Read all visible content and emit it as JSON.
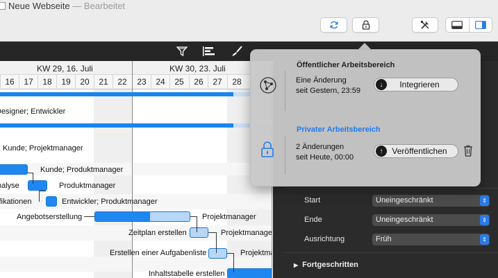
{
  "window": {
    "title": "Neue Webseite",
    "separator": "—",
    "status": "Bearbeitet"
  },
  "toolbar": {
    "sync_icon": "sync-icon",
    "lock_icon": "lock-icon",
    "tools_icon": "tools-icon",
    "layout_icons": [
      "layout-bottom-icon",
      "layout-right-icon"
    ]
  },
  "inspector_toolbar": {
    "icons": [
      "filter-icon",
      "alignment-icon",
      "brush-icon"
    ]
  },
  "gantt": {
    "weeks": [
      "KW 29, 16. Juli",
      "KW 30, 23. Juli"
    ],
    "days": [
      "16",
      "17",
      "18",
      "19",
      "20",
      "21",
      "22",
      "23",
      "24",
      "25",
      "26",
      "27",
      "28"
    ],
    "rows": [
      {
        "label": "Designer; Entwickler"
      },
      {
        "label": "Kunde; Projektmanager"
      },
      {
        "label": "Kunde; Produktmanager"
      },
      {
        "label": "nalyse"
      },
      {
        "label": "Produktmanager"
      },
      {
        "label": "ifikationen"
      },
      {
        "label": "Entwickler; Produktmanager"
      },
      {
        "label": "Angebotserstellung"
      },
      {
        "label": "Projektmanager"
      },
      {
        "label": "Zeitplan erstellen"
      },
      {
        "label": "Projektmanager"
      },
      {
        "label": "Erstellen einer Aufgabenliste"
      },
      {
        "label": "Projektmanager"
      },
      {
        "label": "Inhaltstabelle erstellen"
      }
    ]
  },
  "inspector": {
    "fields": [
      {
        "label": "Start",
        "value": "Uneingeschränkt"
      },
      {
        "label": "Ende",
        "value": "Uneingeschränkt"
      },
      {
        "label": "Ausrichtung",
        "value": "Früh"
      }
    ],
    "advanced_label": "Fortgeschritten"
  },
  "popover": {
    "public": {
      "heading": "Öffentlicher Arbeitsbereich",
      "line1": "Eine Änderung",
      "line2": "seit Gestern, 23:59",
      "button": "Integrieren",
      "icon": "public-workspace-icon"
    },
    "private": {
      "heading": "Privater Arbeitsbereich",
      "line1": "2 Änderungen",
      "line2": "seit Heute, 00:00",
      "button": "Veröffentlichen",
      "icon": "private-lock-icon"
    },
    "colors": {
      "public_heading": "#1a1a1a",
      "private_heading": "#1e7cf2"
    }
  }
}
